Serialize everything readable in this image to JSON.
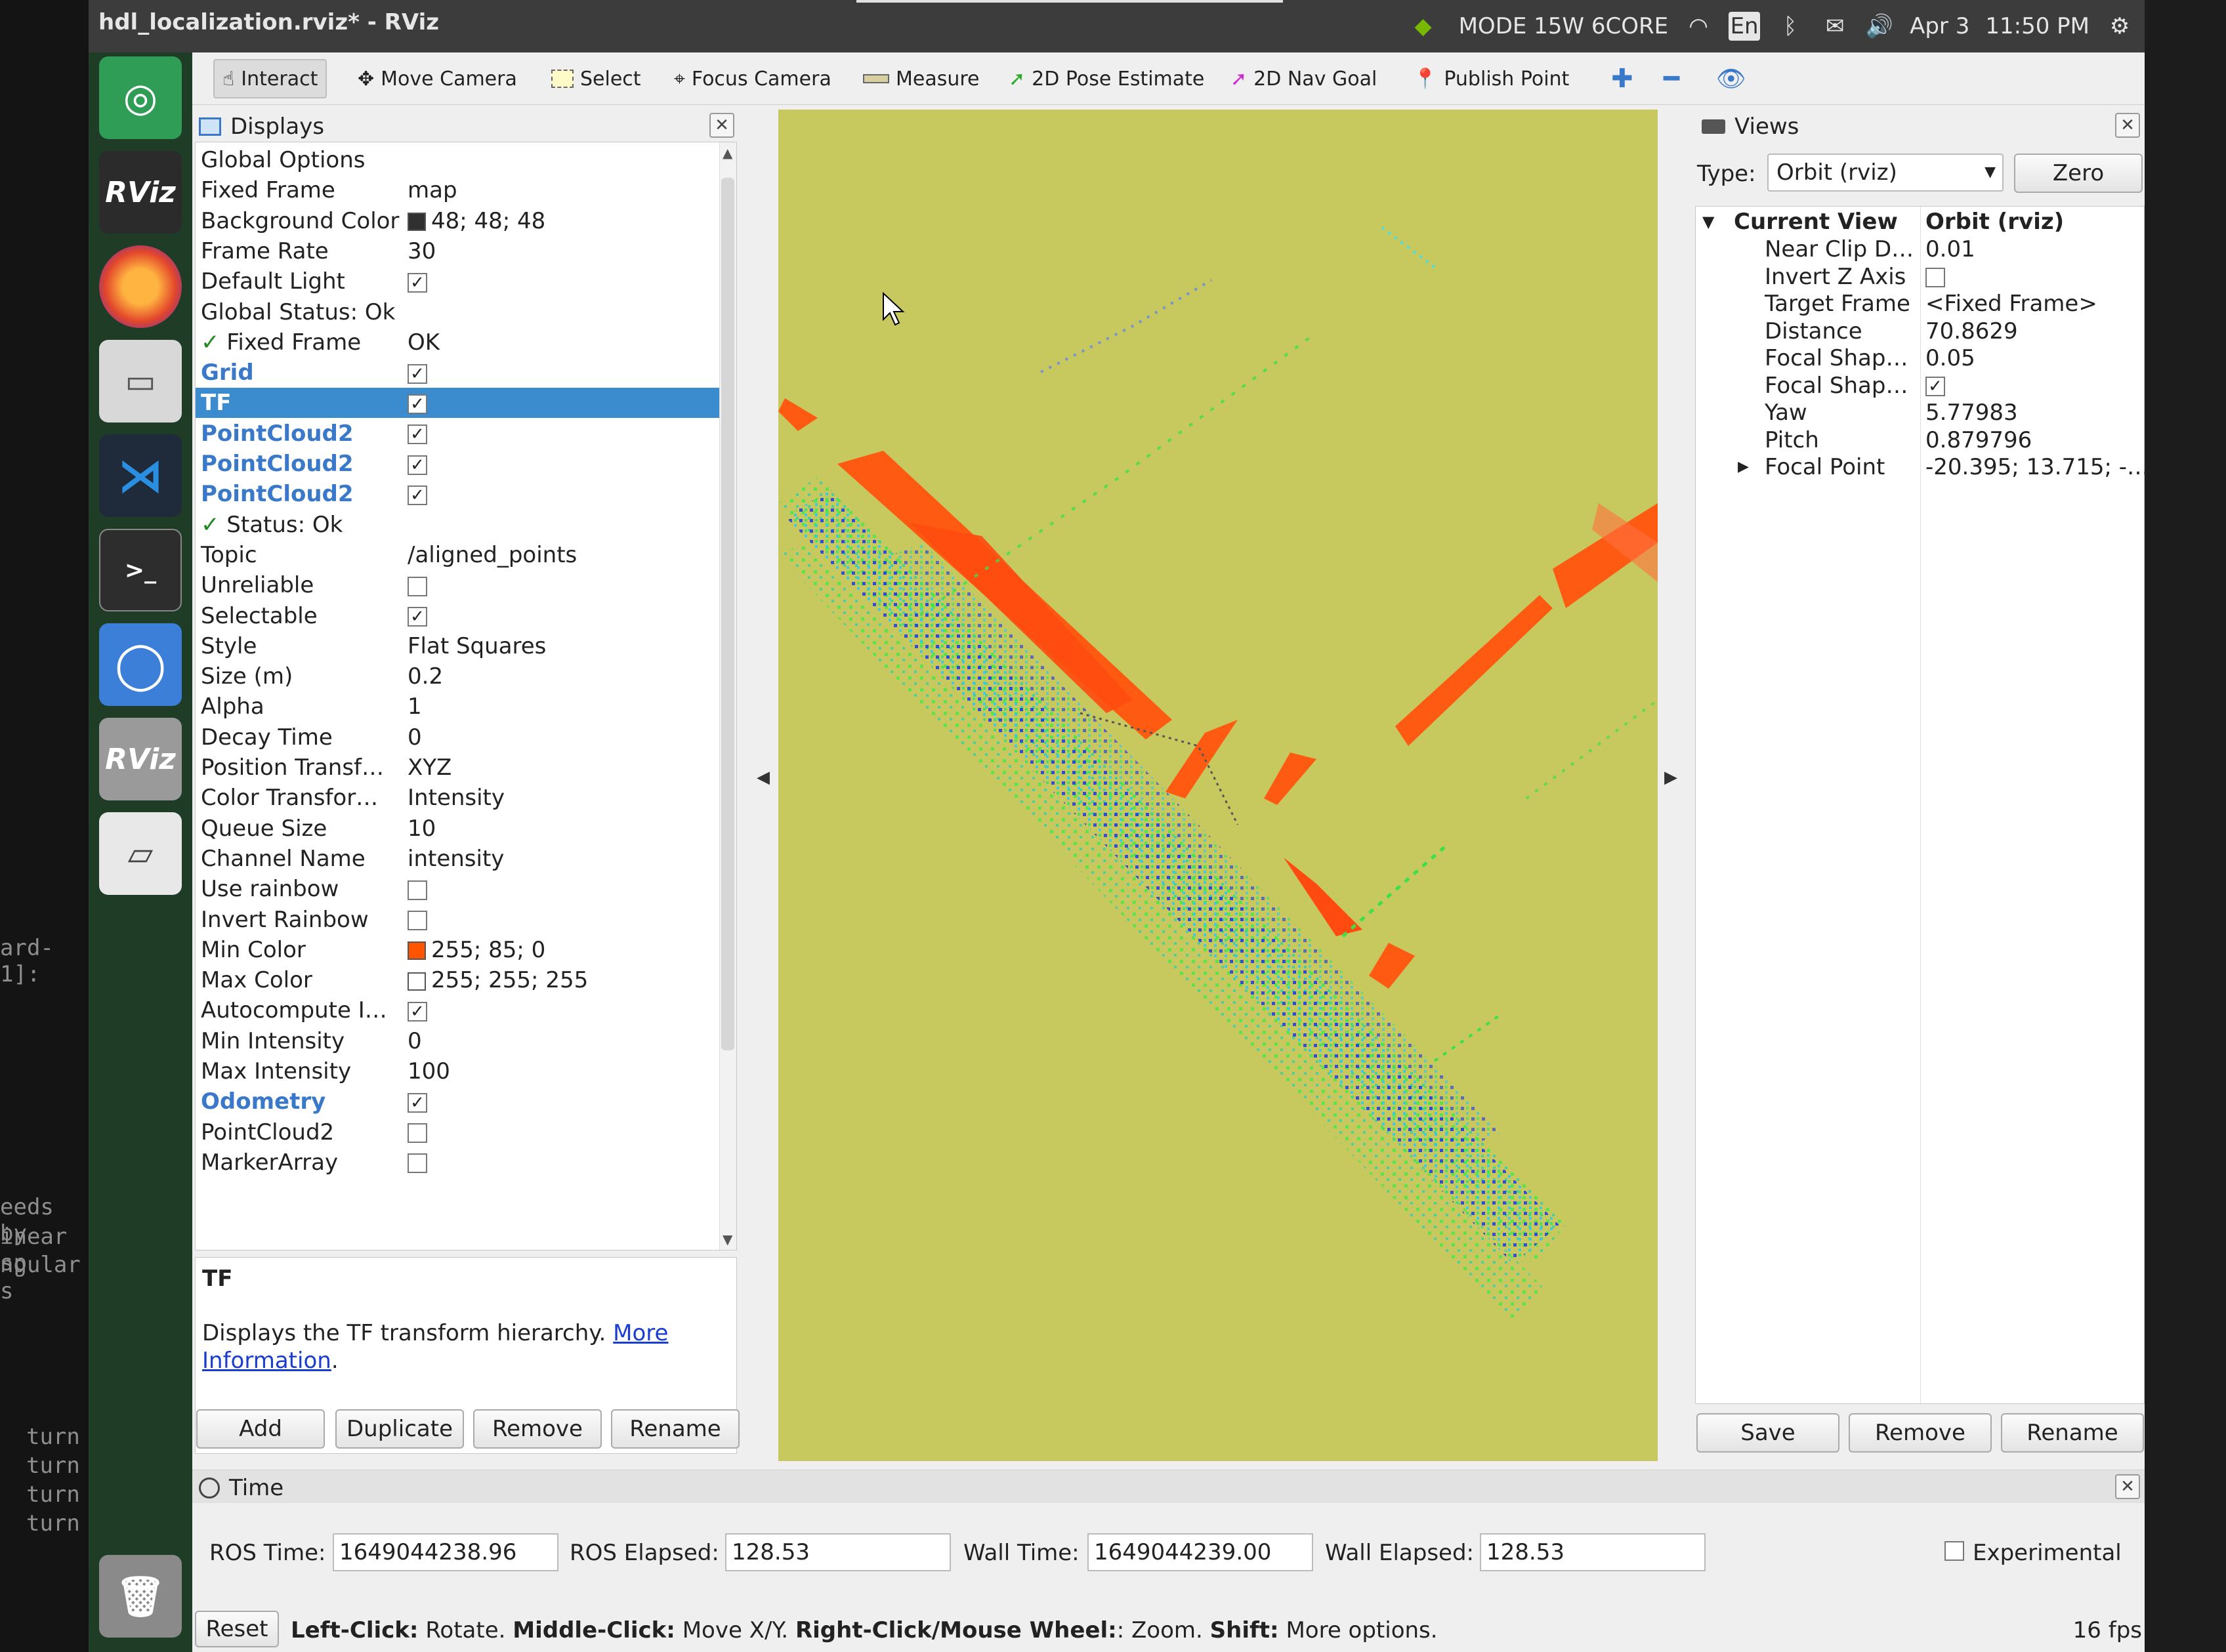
{
  "window_title": "hdl_localization.rviz* - RViz",
  "tray": {
    "nvidia_mode": "MODE 15W 6CORE",
    "keyboard": "En",
    "date": "Apr 3",
    "time": "11:50 PM"
  },
  "terminal_fragments": [
    "ard-1]:",
    "eeds by",
    "inear sp",
    "ngular s",
    "turn",
    "turn",
    "turn",
    "turn"
  ],
  "launcher": [
    "ubuntu-icon",
    "rviz-icon",
    "firefox-icon",
    "files-icon",
    "vscode-icon",
    "terminal-icon",
    "chromium-icon",
    "rviz-icon",
    "drive-icon",
    "trash-icon"
  ],
  "toolbar": {
    "interact": "Interact",
    "move_camera": "Move Camera",
    "select": "Select",
    "focus_camera": "Focus Camera",
    "measure": "Measure",
    "pose_estimate": "2D Pose Estimate",
    "nav_goal": "2D Nav Goal",
    "publish_point": "Publish Point"
  },
  "displays": {
    "title": "Displays",
    "rows": [
      {
        "name": "Global Options",
        "value": ""
      },
      {
        "name": "Fixed Frame",
        "value": "map"
      },
      {
        "name": "Background Color",
        "value": "48; 48; 48"
      },
      {
        "name": "Frame Rate",
        "value": "30"
      },
      {
        "name": "Default Light",
        "value": ""
      },
      {
        "name": "Global Status: Ok",
        "value": ""
      },
      {
        "name": "Fixed Frame",
        "value": "OK"
      },
      {
        "name": "Grid",
        "value": ""
      },
      {
        "name": "TF",
        "value": ""
      },
      {
        "name": "PointCloud2",
        "value": ""
      },
      {
        "name": "PointCloud2",
        "value": ""
      },
      {
        "name": "PointCloud2",
        "value": ""
      },
      {
        "name": "Status: Ok",
        "value": ""
      },
      {
        "name": "Topic",
        "value": "/aligned_points"
      },
      {
        "name": "Unreliable",
        "value": ""
      },
      {
        "name": "Selectable",
        "value": ""
      },
      {
        "name": "Style",
        "value": "Flat Squares"
      },
      {
        "name": "Size (m)",
        "value": "0.2"
      },
      {
        "name": "Alpha",
        "value": "1"
      },
      {
        "name": "Decay Time",
        "value": "0"
      },
      {
        "name": "Position Transf…",
        "value": "XYZ"
      },
      {
        "name": "Color Transfor…",
        "value": "Intensity"
      },
      {
        "name": "Queue Size",
        "value": "10"
      },
      {
        "name": "Channel Name",
        "value": "intensity"
      },
      {
        "name": "Use rainbow",
        "value": ""
      },
      {
        "name": "Invert Rainbow",
        "value": ""
      },
      {
        "name": "Min Color",
        "value": "255; 85; 0"
      },
      {
        "name": "Max Color",
        "value": "255; 255; 255"
      },
      {
        "name": "Autocompute I…",
        "value": ""
      },
      {
        "name": "Min Intensity",
        "value": "0"
      },
      {
        "name": "Max Intensity",
        "value": "100"
      },
      {
        "name": "Odometry",
        "value": ""
      },
      {
        "name": "PointCloud2",
        "value": ""
      },
      {
        "name": "MarkerArray",
        "value": ""
      }
    ],
    "description_title": "TF",
    "description_text": "Displays the TF transform hierarchy. ",
    "description_link1": "More",
    "description_link2": "Information",
    "buttons": {
      "add": "Add",
      "duplicate": "Duplicate",
      "remove": "Remove",
      "rename": "Rename"
    }
  },
  "views": {
    "title": "Views",
    "type_label": "Type:",
    "type_value": "Orbit (rviz)",
    "zero": "Zero",
    "current_view": "Current View",
    "current_view_value": "Orbit (rviz)",
    "rows": [
      {
        "name": "Near Clip D…",
        "value": "0.01"
      },
      {
        "name": "Invert Z Axis",
        "value": ""
      },
      {
        "name": "Target Frame",
        "value": "<Fixed Frame>"
      },
      {
        "name": "Distance",
        "value": "70.8629"
      },
      {
        "name": "Focal Shap…",
        "value": "0.05"
      },
      {
        "name": "Focal Shap…",
        "value": ""
      },
      {
        "name": "Yaw",
        "value": "5.77983"
      },
      {
        "name": "Pitch",
        "value": "0.879796"
      },
      {
        "name": "Focal Point",
        "value": "-20.395; 13.715; -…"
      }
    ],
    "buttons": {
      "save": "Save",
      "remove": "Remove",
      "rename": "Rename"
    }
  },
  "time": {
    "title": "Time",
    "ros_time_label": "ROS Time:",
    "ros_time": "1649044238.96",
    "ros_elapsed_label": "ROS Elapsed:",
    "ros_elapsed": "128.53",
    "wall_time_label": "Wall Time:",
    "wall_time": "1649044239.00",
    "wall_elapsed_label": "Wall Elapsed:",
    "wall_elapsed": "128.53",
    "experimental": "Experimental"
  },
  "status": {
    "reset": "Reset",
    "left_click_key": "Left-Click:",
    "left_click": " Rotate. ",
    "middle_click_key": "Middle-Click:",
    "middle_click": " Move X/Y. ",
    "right_click_key": "Right-Click/Mouse Wheel:",
    "right_click": ": Zoom. ",
    "shift_key": "Shift:",
    "shift": " More options.",
    "fps": "16 fps"
  },
  "colors": {
    "viewport_bg": "#c7c85e",
    "min_color": "#ff5500",
    "selection": "#3a8ccf",
    "link": "#3a78c9"
  }
}
